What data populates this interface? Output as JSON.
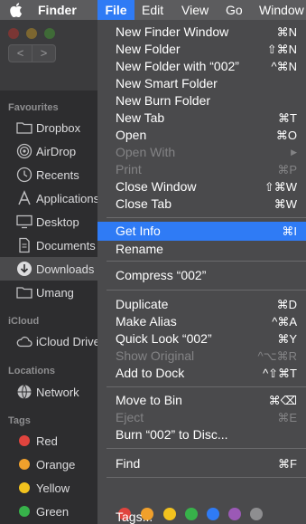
{
  "menubar": {
    "finder": "Finder",
    "file": "File",
    "edit": "Edit",
    "view": "View",
    "go": "Go",
    "window": "Window"
  },
  "toolbar": {
    "back": "<",
    "forward": ">"
  },
  "sidebar": {
    "favourites_heading": "Favourites",
    "favourites": [
      {
        "label": "Dropbox",
        "icon": "folder-icon"
      },
      {
        "label": "AirDrop",
        "icon": "airdrop-icon"
      },
      {
        "label": "Recents",
        "icon": "clock-icon"
      },
      {
        "label": "Applications",
        "icon": "applications-icon"
      },
      {
        "label": "Desktop",
        "icon": "desktop-icon"
      },
      {
        "label": "Documents",
        "icon": "document-icon"
      },
      {
        "label": "Downloads",
        "icon": "download-icon"
      },
      {
        "label": "Umang",
        "icon": "folder-icon"
      }
    ],
    "icloud_heading": "iCloud",
    "icloud": [
      {
        "label": "iCloud Drive",
        "icon": "cloud-icon"
      }
    ],
    "locations_heading": "Locations",
    "locations": [
      {
        "label": "Network",
        "icon": "globe-icon"
      }
    ],
    "tags_heading": "Tags",
    "tags": [
      {
        "label": "Red",
        "color": "#e0443e"
      },
      {
        "label": "Orange",
        "color": "#f0a02c"
      },
      {
        "label": "Yellow",
        "color": "#f2c21e"
      },
      {
        "label": "Green",
        "color": "#37b24a"
      }
    ]
  },
  "menu": {
    "items": [
      {
        "label": "New Finder Window",
        "shortcut": "⌘N"
      },
      {
        "label": "New Folder",
        "shortcut": "⇧⌘N"
      },
      {
        "label": "New Folder with “002”",
        "shortcut": "^⌘N"
      },
      {
        "label": "New Smart Folder",
        "shortcut": ""
      },
      {
        "label": "New Burn Folder",
        "shortcut": ""
      },
      {
        "label": "New Tab",
        "shortcut": "⌘T"
      },
      {
        "label": "Open",
        "shortcut": "⌘O"
      },
      {
        "label": "Open With",
        "shortcut": "▶"
      },
      {
        "label": "Print",
        "shortcut": "⌘P"
      },
      {
        "label": "Close Window",
        "shortcut": "⇧⌘W"
      },
      {
        "label": "Close Tab",
        "shortcut": "⌘W"
      },
      {
        "label": "Get Info",
        "shortcut": "⌘I"
      },
      {
        "label": "Rename",
        "shortcut": ""
      },
      {
        "label": "Compress “002”",
        "shortcut": ""
      },
      {
        "label": "Duplicate",
        "shortcut": "⌘D"
      },
      {
        "label": "Make Alias",
        "shortcut": "^⌘A"
      },
      {
        "label": "Quick Look “002”",
        "shortcut": "⌘Y"
      },
      {
        "label": "Show Original",
        "shortcut": "^⌥⌘R"
      },
      {
        "label": "Add to Dock",
        "shortcut": "^⇧⌘T"
      },
      {
        "label": "Move to Bin",
        "shortcut": "⌘⌫"
      },
      {
        "label": "Eject",
        "shortcut": "⌘E"
      },
      {
        "label": "Burn “002” to Disc...",
        "shortcut": ""
      },
      {
        "label": "Find",
        "shortcut": "⌘F"
      },
      {
        "label": "Tags...",
        "shortcut": ""
      }
    ],
    "tag_colors": [
      "#e0443e",
      "#f0a02c",
      "#f2c21e",
      "#37b24a",
      "#2f7bf5",
      "#9b59b6",
      "#8e8e90"
    ]
  }
}
